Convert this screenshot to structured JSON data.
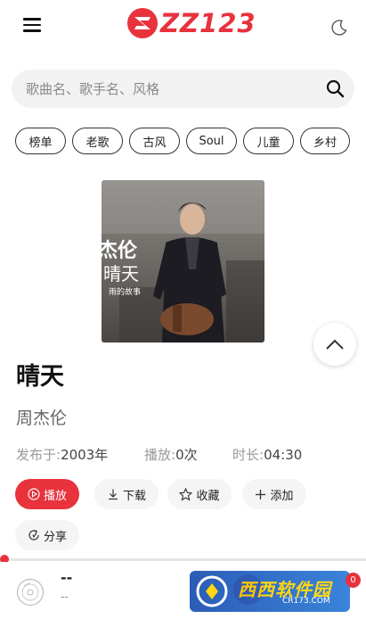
{
  "header": {
    "logo_text": "ZZ123",
    "brand_color": "#e8323c"
  },
  "search": {
    "placeholder": "歌曲名、歌手名、风格",
    "value": ""
  },
  "tags": [
    "榜单",
    "老歌",
    "古风",
    "Soul",
    "儿童",
    "乡村"
  ],
  "cover": {
    "artist_text": "杰伦",
    "title_text": "晴天",
    "sub_text": "雨的故事"
  },
  "song": {
    "title": "晴天",
    "artist": "周杰伦",
    "release_label": "发布于:",
    "release_value": "2003年",
    "plays_label": "播放:",
    "plays_value": "0次",
    "duration_label": "时长:",
    "duration_value": "04:30"
  },
  "actions": {
    "play": "播放",
    "download": "下载",
    "favorite": "收藏",
    "add": "添加",
    "share": "分享"
  },
  "player": {
    "title": "--",
    "artist": "--",
    "progress": 0,
    "badge_count": "0"
  },
  "watermark": {
    "main_text": "西西软件园",
    "sub_text": "CR173.COM"
  },
  "icons": {
    "menu": "menu-icon",
    "moon": "moon-icon",
    "search": "search-icon",
    "scroll_top": "chevron-up-icon",
    "play": "play-icon",
    "download": "download-icon",
    "favorite": "star-icon",
    "add": "plus-icon",
    "share": "share-icon",
    "disc": "disc-icon"
  }
}
